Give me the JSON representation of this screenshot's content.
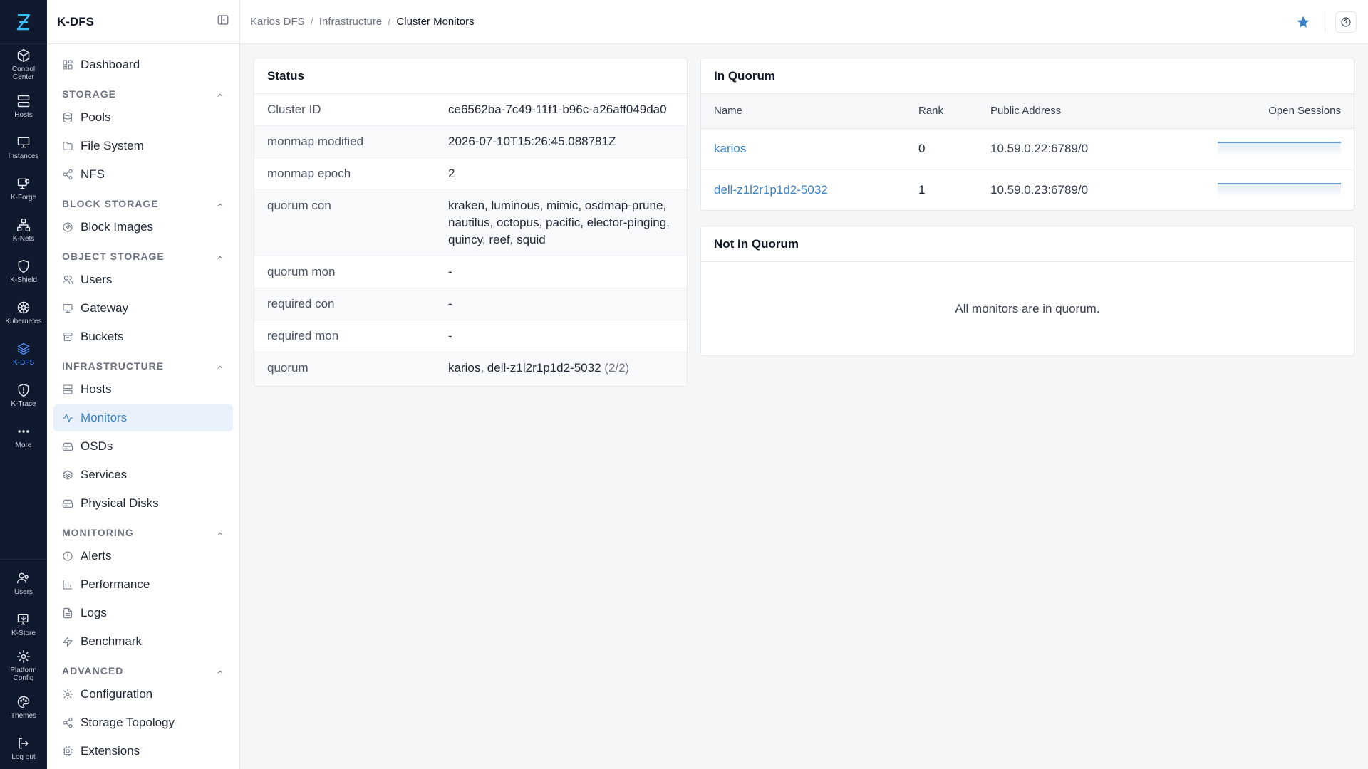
{
  "rail": {
    "items": [
      {
        "label": "Control\nCenter",
        "icon": "cube-icon"
      },
      {
        "label": "Hosts",
        "icon": "server-icon"
      },
      {
        "label": "Instances",
        "icon": "monitor-icon"
      },
      {
        "label": "K-Forge",
        "icon": "forge-icon"
      },
      {
        "label": "K-Nets",
        "icon": "network-icon"
      },
      {
        "label": "K-Shield",
        "icon": "shield-icon"
      },
      {
        "label": "Kubernetes",
        "icon": "helm-icon"
      },
      {
        "label": "K-DFS",
        "icon": "layers-icon"
      },
      {
        "label": "K-Trace",
        "icon": "trace-icon"
      },
      {
        "label": "More",
        "icon": "more-icon"
      }
    ],
    "bottom": [
      {
        "label": "Users",
        "icon": "users-icon"
      },
      {
        "label": "K-Store",
        "icon": "store-icon"
      },
      {
        "label": "Platform\nConfig",
        "icon": "gear-icon"
      },
      {
        "label": "Themes",
        "icon": "palette-icon"
      },
      {
        "label": "Log out",
        "icon": "logout-icon"
      }
    ]
  },
  "sidebar": {
    "title": "K-DFS",
    "dashboard": "Dashboard",
    "sections": {
      "storage": {
        "label": "STORAGE",
        "items": [
          "Pools",
          "File System",
          "NFS"
        ]
      },
      "block": {
        "label": "BLOCK STORAGE",
        "items": [
          "Block Images"
        ]
      },
      "object": {
        "label": "OBJECT STORAGE",
        "items": [
          "Users",
          "Gateway",
          "Buckets"
        ]
      },
      "infra": {
        "label": "INFRASTRUCTURE",
        "items": [
          "Hosts",
          "Monitors",
          "OSDs",
          "Services",
          "Physical Disks"
        ]
      },
      "monitoring": {
        "label": "MONITORING",
        "items": [
          "Alerts",
          "Performance",
          "Logs",
          "Benchmark"
        ]
      },
      "advanced": {
        "label": "ADVANCED",
        "items": [
          "Configuration",
          "Storage Topology",
          "Extensions"
        ]
      }
    }
  },
  "breadcrumb": {
    "root": "Karios DFS",
    "middle": "Infrastructure",
    "current": "Cluster Monitors",
    "sep": "/"
  },
  "status": {
    "title": "Status",
    "rows": [
      {
        "key": "Cluster ID",
        "value": "ce6562ba-7c49-11f1-b96c-a26aff049da0"
      },
      {
        "key": "monmap modified",
        "value": "2026-07-10T15:26:45.088781Z"
      },
      {
        "key": "monmap epoch",
        "value": "2"
      },
      {
        "key": "quorum con",
        "value": "kraken, luminous, mimic, osdmap-prune, nautilus, octopus, pacific, elector-pinging, quincy, reef, squid"
      },
      {
        "key": "quorum mon",
        "value": "-"
      },
      {
        "key": "required con",
        "value": "-"
      },
      {
        "key": "required mon",
        "value": "-"
      },
      {
        "key": "quorum",
        "value": "karios, dell-z1l2r1p1d2-5032",
        "suffix": "(2/2)"
      }
    ]
  },
  "in_quorum": {
    "title": "In Quorum",
    "columns": [
      "Name",
      "Rank",
      "Public Address",
      "Open Sessions"
    ],
    "rows": [
      {
        "name": "karios",
        "rank": "0",
        "address": "10.59.0.22:6789/0"
      },
      {
        "name": "dell-z1l2r1p1d2-5032",
        "rank": "1",
        "address": "10.59.0.23:6789/0"
      }
    ]
  },
  "not_in_quorum": {
    "title": "Not In Quorum",
    "empty": "All monitors are in quorum."
  },
  "colors": {
    "accent": "#3b82c4",
    "rail_bg": "#0f1a2e",
    "rail_active": "#4f8ff7"
  }
}
